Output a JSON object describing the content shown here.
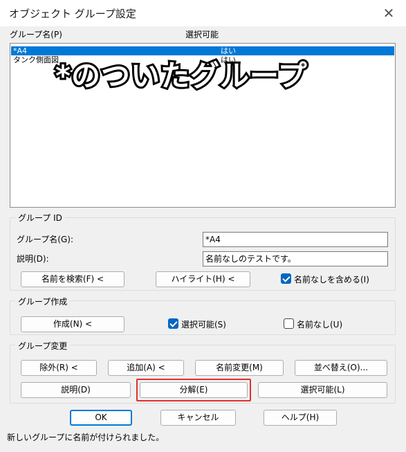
{
  "window": {
    "title": "オブジェクト グループ設定",
    "close_glyph": "✕"
  },
  "list": {
    "col_name": "グループ名(P)",
    "col_selectable": "選択可能",
    "rows": [
      {
        "name": "*A4",
        "selectable": "はい",
        "selected": true
      },
      {
        "name": "タンク側面図",
        "selectable": "はい",
        "selected": false
      }
    ]
  },
  "overlay_caption": "*のついたグループ",
  "group_id": {
    "label": "グループ ID",
    "name_label": "グループ名(G):",
    "name_value": "*A4",
    "desc_label": "説明(D):",
    "desc_value": "名前なしのテストです。",
    "find_button": "名前を検索(F) <",
    "highlight_button": "ハイライト(H) <",
    "include_unnamed_label": "名前なしを含める(I)",
    "include_unnamed_checked": true
  },
  "create": {
    "label": "グループ作成",
    "new_button": "作成(N) <",
    "selectable_label": "選択可能(S)",
    "selectable_checked": true,
    "unnamed_label": "名前なし(U)",
    "unnamed_checked": false
  },
  "change": {
    "label": "グループ変更",
    "remove_button": "除外(R) <",
    "add_button": "追加(A) <",
    "rename_button": "名前変更(M)",
    "reorder_button": "並べ替え(O)...",
    "description_button": "説明(D)",
    "explode_button": "分解(E)",
    "selectable_button": "選択可能(L)"
  },
  "footer": {
    "ok_button": "OK",
    "cancel_button": "キャンセル",
    "help_button": "ヘルプ(H)"
  },
  "status_text": "新しいグループに名前が付けられました。",
  "colors": {
    "selection": "#0078d7",
    "highlight_box": "#e03030",
    "checkbox": "#0067c0"
  }
}
